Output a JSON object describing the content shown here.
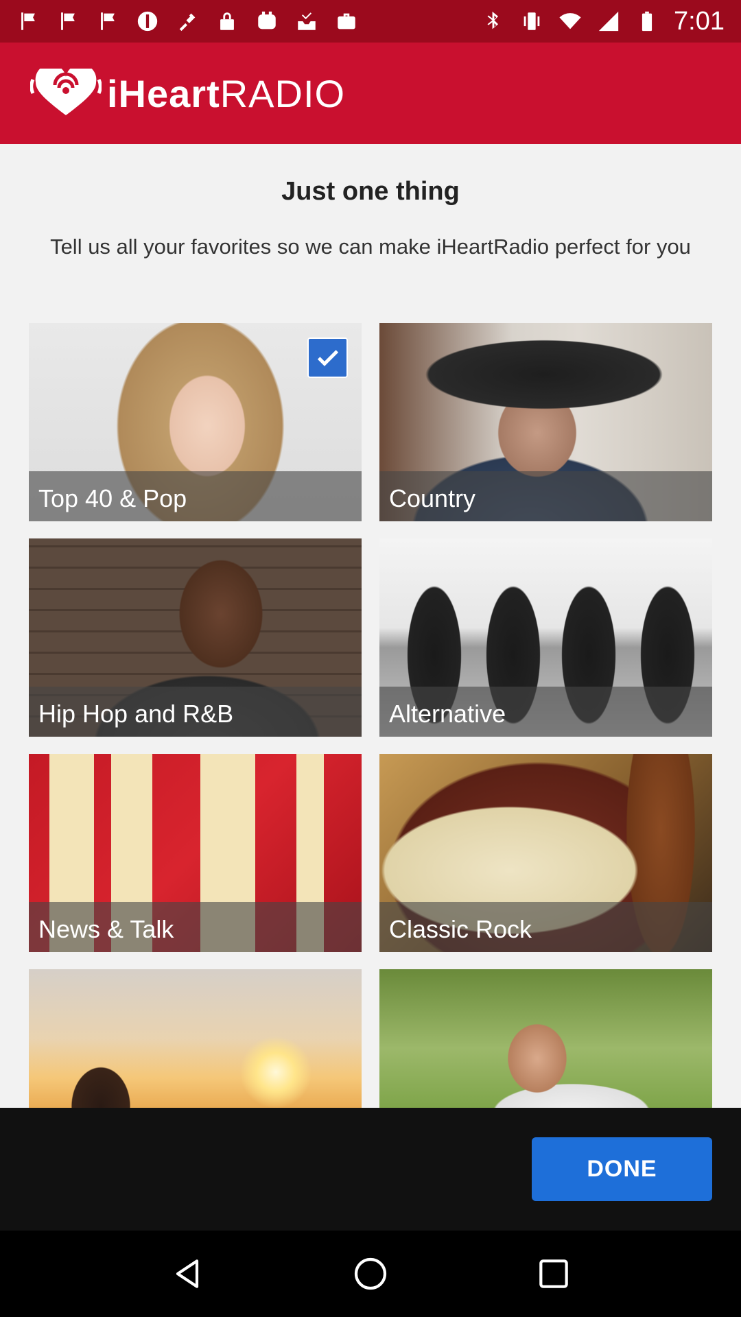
{
  "status_bar": {
    "time": "7:01",
    "left_icons": [
      "flag-icon",
      "flag-icon",
      "flag-icon",
      "no-entry-icon",
      "fake-gps-icon",
      "lock-icon",
      "app-icon",
      "inbox-icon",
      "briefcase-icon"
    ],
    "right_icons": [
      "bluetooth-icon",
      "vibrate-icon",
      "wifi-icon",
      "signal-icon",
      "battery-icon"
    ]
  },
  "brand": {
    "logo_prefix": "iHeart",
    "logo_suffix": "RADIO",
    "color": "#c9102f"
  },
  "main": {
    "title": "Just one thing",
    "subtitle": "Tell us all your favorites so we can make iHeartRadio perfect for you"
  },
  "genres": [
    {
      "label": "Top 40 & Pop",
      "selected": true
    },
    {
      "label": "Country",
      "selected": false
    },
    {
      "label": "Hip Hop and R&B",
      "selected": false
    },
    {
      "label": "Alternative",
      "selected": false
    },
    {
      "label": "News & Talk",
      "selected": false
    },
    {
      "label": "Classic Rock",
      "selected": false
    },
    {
      "label": "",
      "selected": false
    },
    {
      "label": "",
      "selected": false
    }
  ],
  "footer": {
    "done_label": "DONE",
    "accent": "#1e6fd9"
  },
  "nav": {
    "icons": [
      "back-icon",
      "home-icon",
      "recents-icon"
    ]
  }
}
